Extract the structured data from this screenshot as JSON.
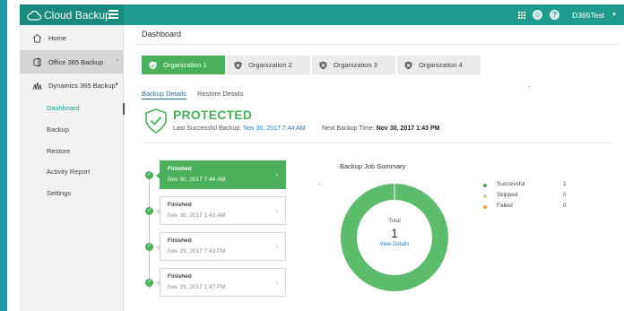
{
  "app": {
    "brand": "Cloud Backup",
    "user": "D365Test"
  },
  "colors": {
    "teal": "#1f9c8f",
    "green": "#4caf5c",
    "link": "#2a7ab8",
    "skipped": "#b7d99a",
    "failed": "#f0a830"
  },
  "sidebar": {
    "home": "Home",
    "office365": "Office 365 Backup",
    "dynamics": "Dynamics 365 Backup",
    "sub": [
      "Dashboard",
      "Backup",
      "Restore",
      "Activity Report",
      "Settings"
    ]
  },
  "main": {
    "title": "Dashboard",
    "org_tabs": [
      "Organization 1",
      "Organization 2",
      "Organization 3",
      "Organization 4"
    ],
    "sub_tabs": [
      "Backup Details",
      "Restore Details"
    ],
    "status": "PROTECTED",
    "last_label": "Last Successful Backup:",
    "last_value": "Nov 30, 2017 7:44 AM",
    "next_label": "Next Backup Time:",
    "next_value": "Nov 30, 2017 1:43 PM"
  },
  "jobs": [
    {
      "status": "Finished",
      "date": "Nov 30, 2017 7:44 AM"
    },
    {
      "status": "Finished",
      "date": "Nov 30, 2017 1:43 AM"
    },
    {
      "status": "Finished",
      "date": "Nov 29, 2017 7:43 PM"
    },
    {
      "status": "Finished",
      "date": "Nov 29, 2017 1:47 PM"
    }
  ],
  "summary": {
    "title": "Backup Job Summary",
    "total_label": "Total",
    "total_value": "1",
    "view_details": "View Details",
    "legend": [
      {
        "name": "Successful",
        "value": "1"
      },
      {
        "name": "Skipped",
        "value": "0"
      },
      {
        "name": "Failed",
        "value": "0"
      }
    ]
  }
}
